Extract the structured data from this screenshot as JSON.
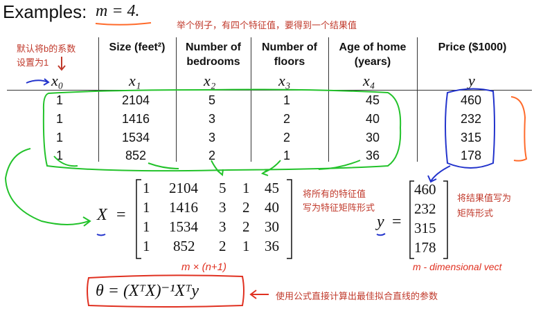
{
  "title": {
    "label": "Examples:",
    "m_expr": "m = 4."
  },
  "notes": {
    "top": "举个例子，有四个特征值，要得到一个结果值",
    "bias_line1": "默认将b的系数",
    "bias_line2": "设置为1",
    "features_line1": "将所有的特征值",
    "features_line2": "写为特征矩阵形式",
    "result_line1": "将结果值写为",
    "result_line2": "矩阵形式",
    "formula_note": "使用公式直接计算出最佳拟合直线的参数",
    "dims": "m × (n+1)",
    "m_dim": "m - dimensional vect"
  },
  "table": {
    "headers": [
      {
        "line1": "",
        "line2": ""
      },
      {
        "line1": "Size (feet²)",
        "line2": ""
      },
      {
        "line1": "Number of",
        "line2": "bedrooms"
      },
      {
        "line1": "Number of",
        "line2": "floors"
      },
      {
        "line1": "Age of home",
        "line2": "(years)"
      },
      {
        "line1": "Price ($1000)",
        "line2": ""
      }
    ],
    "symbols": [
      "x₀",
      "x₁",
      "x₂",
      "x₃",
      "x₄",
      "y"
    ],
    "rows": [
      [
        "1",
        "2104",
        "5",
        "1",
        "45",
        "460"
      ],
      [
        "1",
        "1416",
        "3",
        "2",
        "40",
        "232"
      ],
      [
        "1",
        "1534",
        "3",
        "2",
        "30",
        "315"
      ],
      [
        "1",
        "852",
        "2",
        "1",
        "36",
        "178"
      ]
    ]
  },
  "matrix_x": {
    "label": "X",
    "rows": [
      [
        "1",
        "2104",
        "5",
        "1",
        "45"
      ],
      [
        "1",
        "1416",
        "3",
        "2",
        "40"
      ],
      [
        "1",
        "1534",
        "3",
        "2",
        "30"
      ],
      [
        "1",
        "852",
        "2",
        "1",
        "36"
      ]
    ]
  },
  "vector_y": {
    "label": "y",
    "values": [
      "460",
      "232",
      "315",
      "178"
    ]
  },
  "formula": "θ = (XᵀX)⁻¹Xᵀy",
  "colors": {
    "annotation_red": "#c0392b",
    "green": "#22c22a",
    "blue": "#2233cc",
    "orange": "#ff6a2a"
  }
}
